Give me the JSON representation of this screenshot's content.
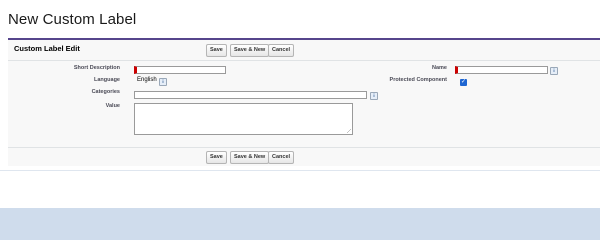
{
  "page": {
    "title": "New Custom Label"
  },
  "block": {
    "title": "Custom Label Edit"
  },
  "buttons": {
    "save": "Save",
    "save_new": "Save & New",
    "cancel": "Cancel"
  },
  "form": {
    "short_description": {
      "label": "Short Description",
      "value": ""
    },
    "name": {
      "label": "Name",
      "value": ""
    },
    "language": {
      "label": "Language",
      "value": "English"
    },
    "protected_component": {
      "label": "Protected Component",
      "checked": true
    },
    "categories": {
      "label": "Categories",
      "value": ""
    },
    "value": {
      "label": "Value",
      "value": ""
    }
  },
  "icons": {
    "info": "i",
    "check": "✓"
  },
  "colors": {
    "accent": "#56458c",
    "required": "#cc0000",
    "checkbox": "#1e66d2"
  }
}
